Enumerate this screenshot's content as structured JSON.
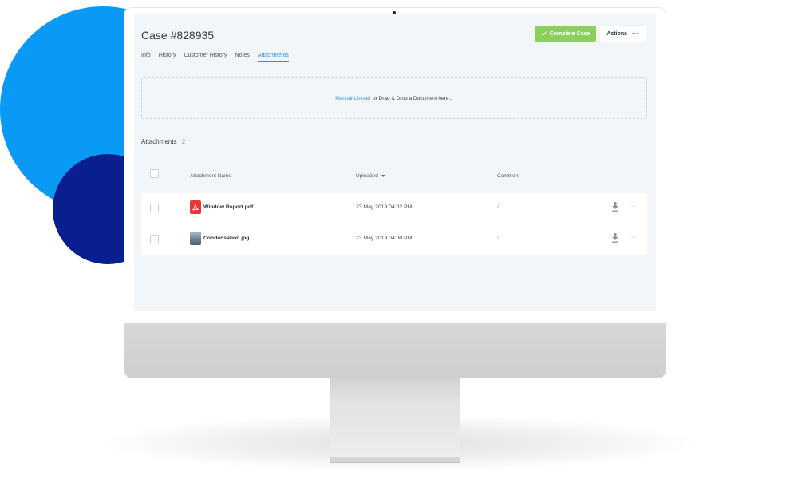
{
  "case": {
    "title": "Case #828935",
    "complete_button": "Complete Case",
    "actions_button": "Actions",
    "actions_dots": "···"
  },
  "tabs": [
    {
      "label": "Info",
      "active": false
    },
    {
      "label": "History",
      "active": false
    },
    {
      "label": "Customer History",
      "active": false
    },
    {
      "label": "Notes",
      "active": false
    },
    {
      "label": "Attachments",
      "active": true
    }
  ],
  "upload": {
    "link": "Manual Upload",
    "text": "or Drag & Drop a Document here..."
  },
  "attachments": {
    "heading": "Attachments",
    "count": "2",
    "columns": {
      "name": "Attachment Name",
      "uploaded": "Uploaded",
      "comment": "Comment"
    },
    "rows": [
      {
        "name": "Window Report.pdf",
        "type_icon": "pdf-icon",
        "uploaded": "23 May 2019 04:02 PM",
        "comment": "/"
      },
      {
        "name": "Condensation.jpg",
        "type_icon": "image-thumbnail",
        "uploaded": "23 May 2019 04:00 PM",
        "comment": "/"
      }
    ],
    "row_more": "···"
  },
  "colors": {
    "accent_blue": "#2d8fe2",
    "complete_green": "#8ccf5c",
    "pdf_red": "#e53935",
    "circle_light": "#0a99f5",
    "circle_dark": "#0a1f8f"
  },
  "icons": {
    "check": "check-icon",
    "sort": "sort-down-icon",
    "download": "download-icon",
    "more": "more-dots-icon"
  }
}
